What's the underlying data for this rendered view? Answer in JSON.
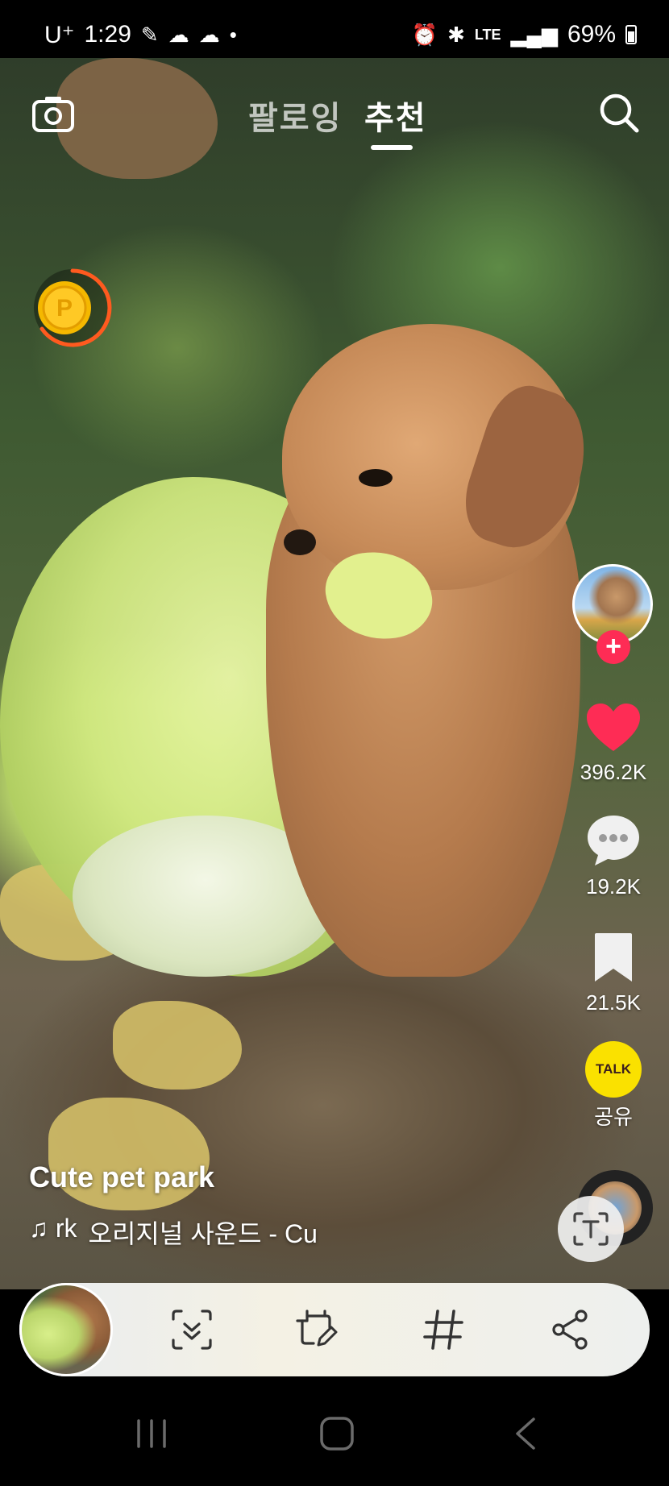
{
  "status_bar": {
    "carrier": "U⁺",
    "time": "1:29",
    "network": "LTE",
    "battery": "69%"
  },
  "top_nav": {
    "tabs": [
      {
        "label": "팔로잉"
      },
      {
        "label": "추천"
      }
    ]
  },
  "video": {
    "author": "Cute pet park",
    "sound_prefix": "♫ rk",
    "sound_title": "오리지널 사운드 - Cu"
  },
  "actions": {
    "likes": "396.2K",
    "comments": "19.2K",
    "saves": "21.5K",
    "share_label": "공유",
    "talk_label": "TALK"
  },
  "colors": {
    "like": "#fe2c55",
    "talk_yellow": "#fae100",
    "coin": "#f5b800",
    "timer_ring": "#ff5a1f"
  }
}
